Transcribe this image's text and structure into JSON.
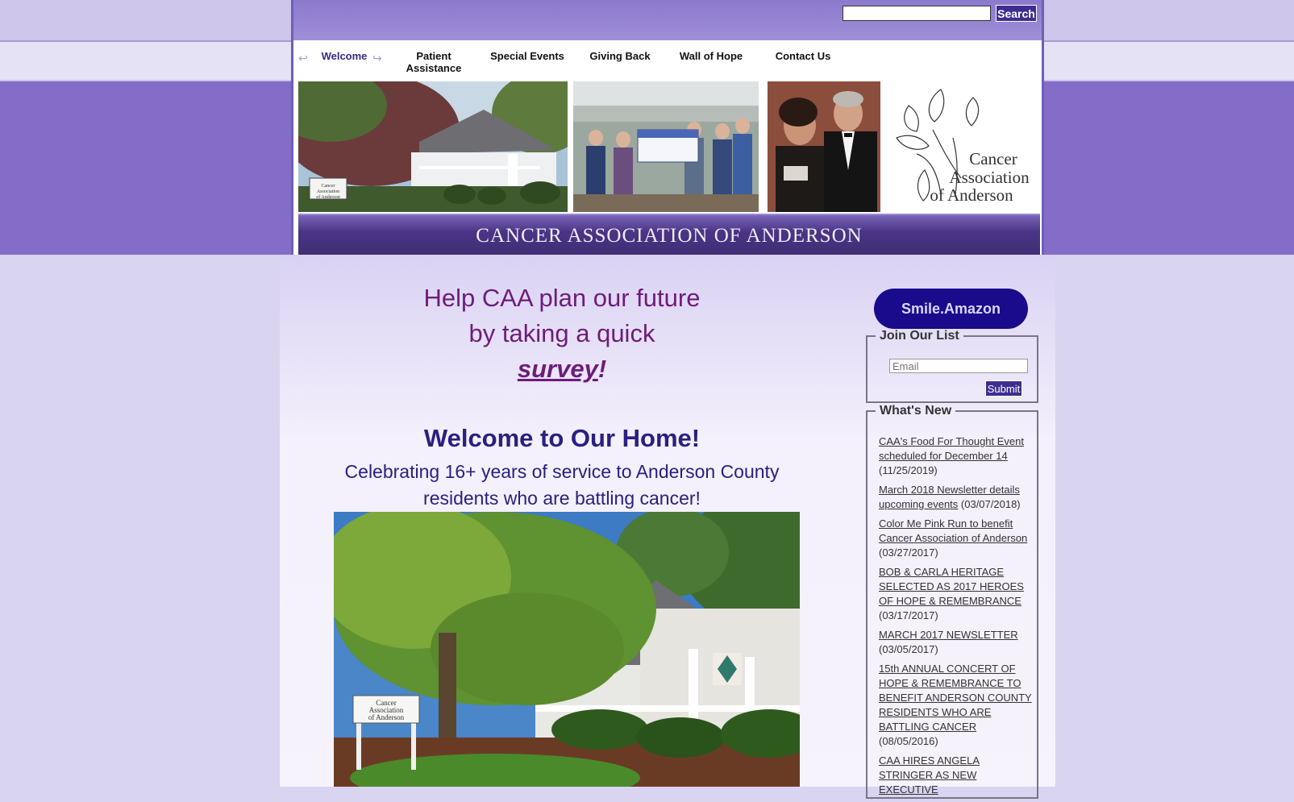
{
  "search": {
    "placeholder": "",
    "button": "Search"
  },
  "nav": {
    "items": [
      {
        "label": "Welcome"
      },
      {
        "label": "Patient Assistance"
      },
      {
        "label": "Special Events"
      },
      {
        "label": "Giving Back"
      },
      {
        "label": "Wall of Hope"
      },
      {
        "label": "Contact Us"
      }
    ]
  },
  "banner": {
    "title": "CANCER ASSOCIATION OF ANDERSON",
    "logo_line1": "Cancer",
    "logo_line2": "Association",
    "logo_line3": "of Anderson",
    "sign_text": "Cancer Association of Anderson"
  },
  "main": {
    "survey_line1": "Help CAA plan our future",
    "survey_line2": "by taking a quick",
    "survey_link": "survey",
    "survey_exclaim": "!",
    "welcome": "Welcome to Our Home!",
    "subtitle_line1": "Celebrating 16+ years of service to Anderson County",
    "subtitle_line2": "residents who are battling cancer!"
  },
  "sidebar": {
    "smile_button": "Smile.Amazon",
    "join_legend": "Join Our List",
    "email_placeholder": "Email",
    "submit": "Submit",
    "news_legend": "What's New",
    "news": [
      {
        "link": "CAA's Food For Thought Event scheduled for December 14",
        "date": "(11/25/2019)"
      },
      {
        "link": "March 2018 Newsletter details upcoming events",
        "date": "(03/07/2018)"
      },
      {
        "link": "Color Me Pink Run to benefit Cancer Association of Anderson",
        "date": "(03/27/2017)"
      },
      {
        "link": "BOB & CARLA HERITAGE SELECTED AS 2017 HEROES OF HOPE & REMEMBRANCE",
        "date": "(03/17/2017)"
      },
      {
        "link": "MARCH 2017 NEWSLETTER",
        "date": "(03/05/2017)"
      },
      {
        "link": "15th ANNUAL CONCERT OF HOPE & REMEMBRANCE TO BENEFIT ANDERSON COUNTY RESIDENTS WHO ARE BATTLING CANCER",
        "date": "(08/05/2016)"
      },
      {
        "link": "CAA HIRES ANGELA STRINGER AS NEW EXECUTIVE",
        "date": ""
      }
    ]
  },
  "colors": {
    "accent": "#3e2e92",
    "banner": "#836dc9",
    "survey": "#6e1c7a",
    "heading": "#2a2080",
    "smile": "#1a0a8c"
  }
}
